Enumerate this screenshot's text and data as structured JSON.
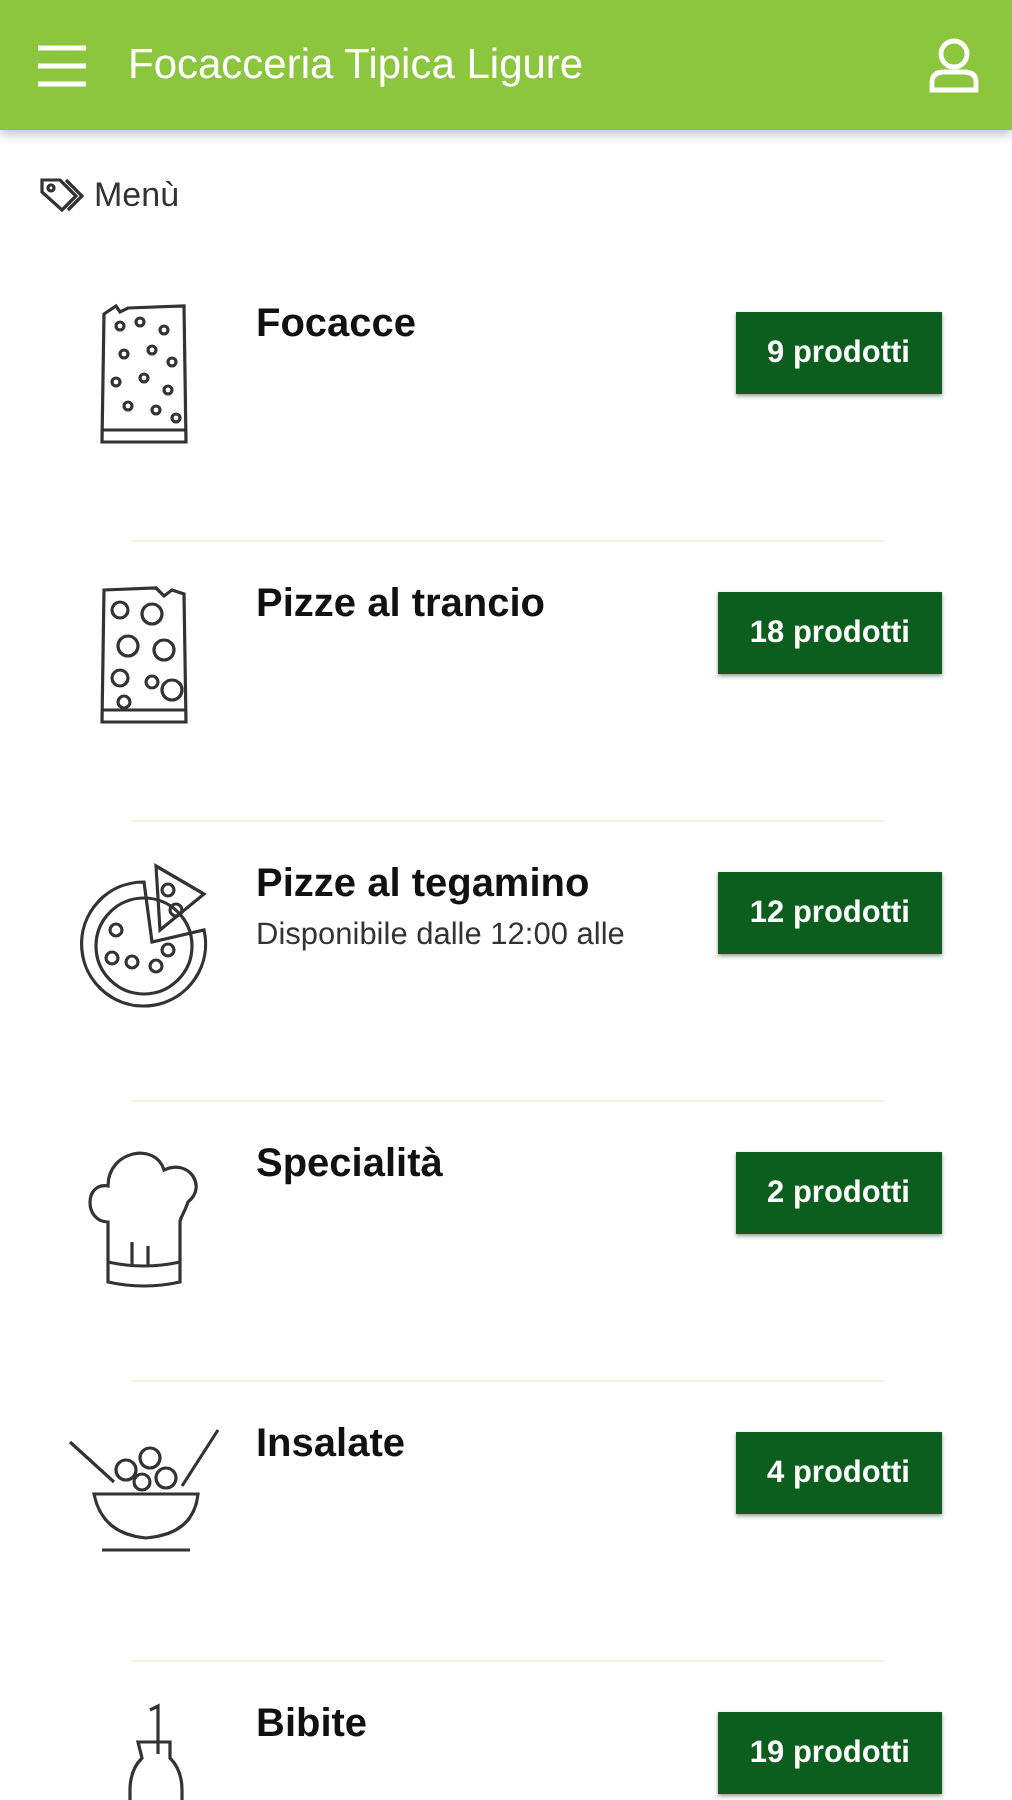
{
  "header": {
    "title": "Focacceria Tipica Ligure"
  },
  "section": {
    "label": "Menù"
  },
  "categories": [
    {
      "kind": "focaccia",
      "name": "Focacce",
      "count": "9 prodotti"
    },
    {
      "kind": "slice",
      "name": "Pizze al trancio",
      "count": "18 prodotti"
    },
    {
      "kind": "pizza",
      "name": "Pizze al tegamino",
      "note": "Disponibile dalle 12:00 alle",
      "count": "12 prodotti"
    },
    {
      "kind": "chef",
      "name": "Specialità",
      "count": "2 prodotti"
    },
    {
      "kind": "salad",
      "name": "Insalate",
      "count": "4 prodotti"
    },
    {
      "kind": "drink",
      "name": "Bibite",
      "count": "19 prodotti"
    }
  ]
}
